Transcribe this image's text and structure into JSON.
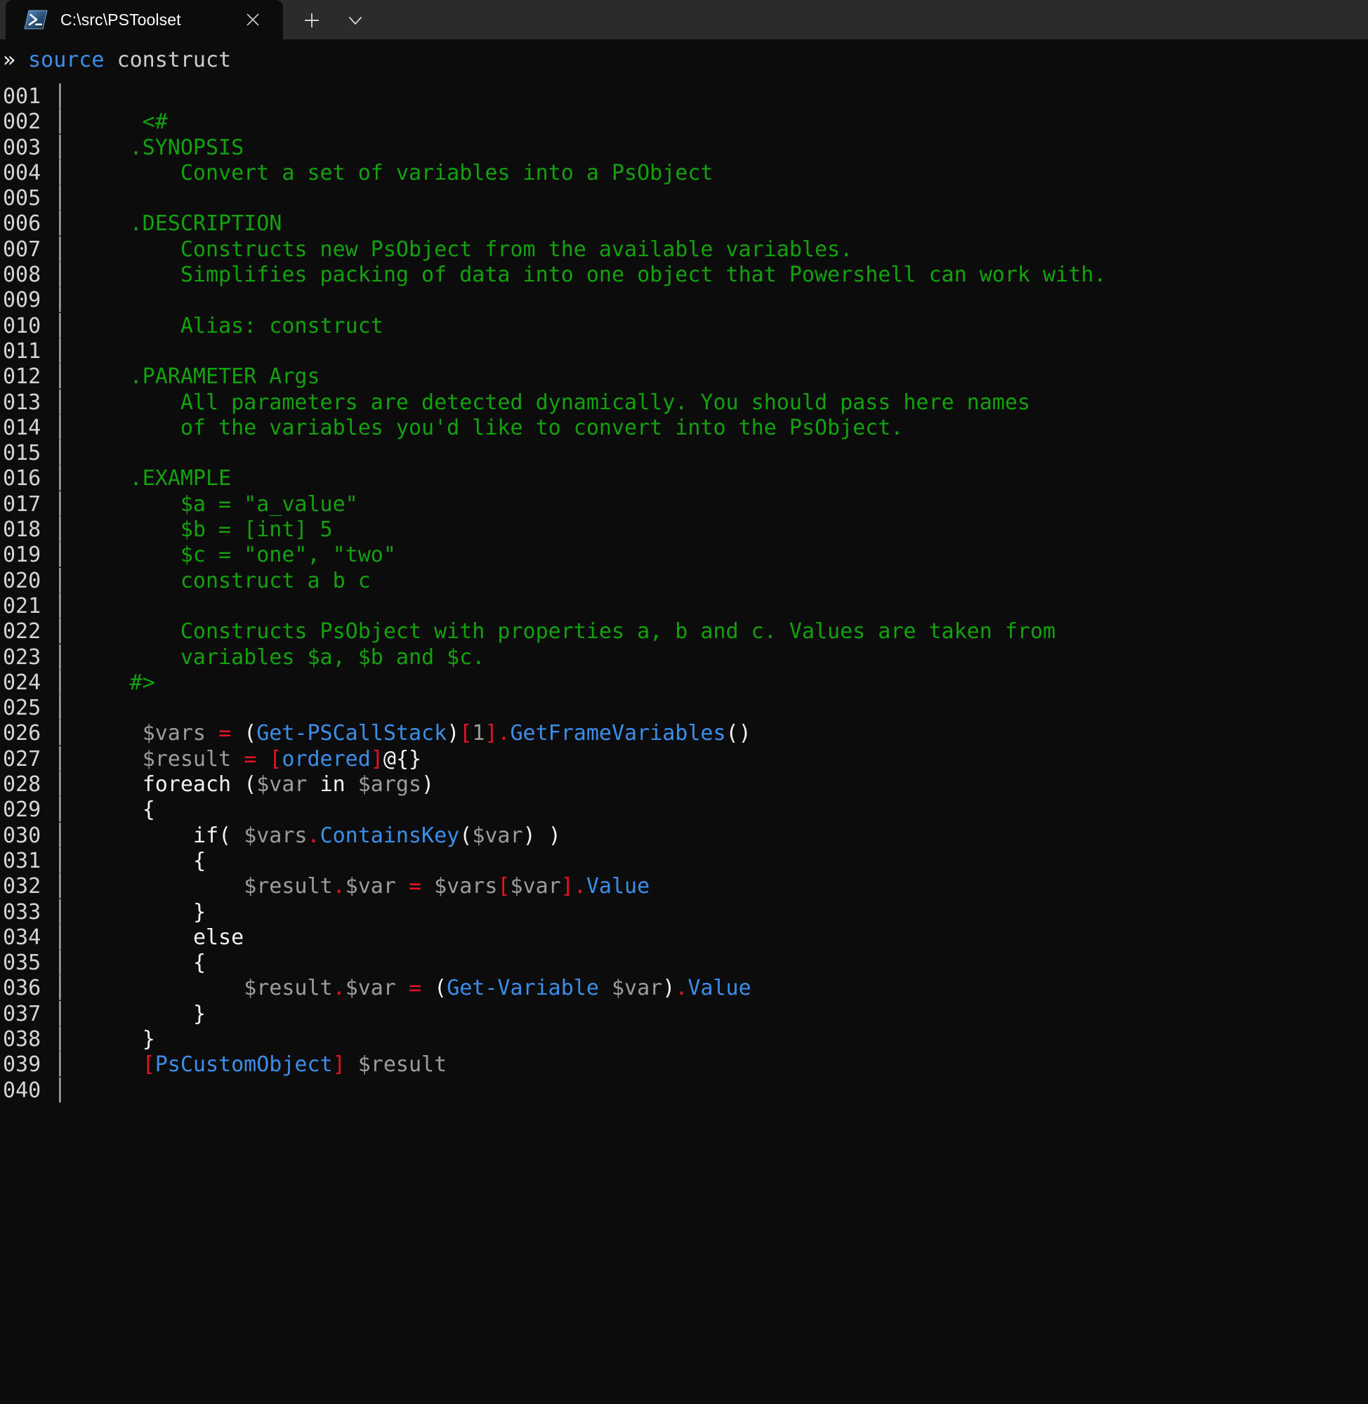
{
  "window": {
    "app": "Windows Terminal",
    "background_color": "#0c0c0c",
    "titlebar_color": "#2b2b2b"
  },
  "tab": {
    "icon": "powershell-icon",
    "title": "C:\\src\\PSToolset",
    "close_label": "✕",
    "new_tab_label": "+",
    "dropdown_label": "∨"
  },
  "prompt": {
    "symbol": "»",
    "command": "source",
    "argument": "construct"
  },
  "colors": {
    "comment": "#13a10e",
    "keyword": "#f2f2f2",
    "variable": "#9c9c9c",
    "operator": "#e81123",
    "cmdlet": "#3b8eea",
    "line_number": "#d4d4d4",
    "gutter_bar": "#b0b0b0",
    "background": "#0c0c0c"
  },
  "listing": {
    "gutter_separator": "│",
    "lines": [
      {
        "n": "001",
        "text": ""
      },
      {
        "n": "002",
        "text": "      <#"
      },
      {
        "n": "003",
        "text": "     .SYNOPSIS"
      },
      {
        "n": "004",
        "text": "         Convert a set of variables into a PsObject"
      },
      {
        "n": "005",
        "text": ""
      },
      {
        "n": "006",
        "text": "     .DESCRIPTION"
      },
      {
        "n": "007",
        "text": "         Constructs new PsObject from the available variables."
      },
      {
        "n": "008",
        "text": "         Simplifies packing of data into one object that Powershell can work with."
      },
      {
        "n": "009",
        "text": ""
      },
      {
        "n": "010",
        "text": "         Alias: construct"
      },
      {
        "n": "011",
        "text": ""
      },
      {
        "n": "012",
        "text": "     .PARAMETER Args"
      },
      {
        "n": "013",
        "text": "         All parameters are detected dynamically. You should pass here names"
      },
      {
        "n": "014",
        "text": "         of the variables you'd like to convert into the PsObject."
      },
      {
        "n": "015",
        "text": ""
      },
      {
        "n": "016",
        "text": "     .EXAMPLE"
      },
      {
        "n": "017",
        "text": "         $a = \"a_value\""
      },
      {
        "n": "018",
        "text": "         $b = [int] 5"
      },
      {
        "n": "019",
        "text": "         $c = \"one\", \"two\""
      },
      {
        "n": "020",
        "text": "         construct a b c"
      },
      {
        "n": "021",
        "text": ""
      },
      {
        "n": "022",
        "text": "         Constructs PsObject with properties a, b and c. Values are taken from"
      },
      {
        "n": "023",
        "text": "         variables $a, $b and $c."
      },
      {
        "n": "024",
        "text": "     #>"
      },
      {
        "n": "025",
        "text": ""
      },
      {
        "n": "026",
        "text": "      $vars = (Get-PSCallStack)[1].GetFrameVariables()"
      },
      {
        "n": "027",
        "text": "      $result = [ordered]@{}"
      },
      {
        "n": "028",
        "text": "      foreach ($var in $args)"
      },
      {
        "n": "029",
        "text": "      {"
      },
      {
        "n": "030",
        "text": "          if( $vars.ContainsKey($var) )"
      },
      {
        "n": "031",
        "text": "          {"
      },
      {
        "n": "032",
        "text": "              $result.$var = $vars[$var].Value"
      },
      {
        "n": "033",
        "text": "          }"
      },
      {
        "n": "034",
        "text": "          else"
      },
      {
        "n": "035",
        "text": "          {"
      },
      {
        "n": "036",
        "text": "              $result.$var = (Get-Variable $var).Value"
      },
      {
        "n": "037",
        "text": "          }"
      },
      {
        "n": "038",
        "text": "      }"
      },
      {
        "n": "039",
        "text": "      [PsCustomObject] $result"
      },
      {
        "n": "040",
        "text": ""
      }
    ]
  }
}
